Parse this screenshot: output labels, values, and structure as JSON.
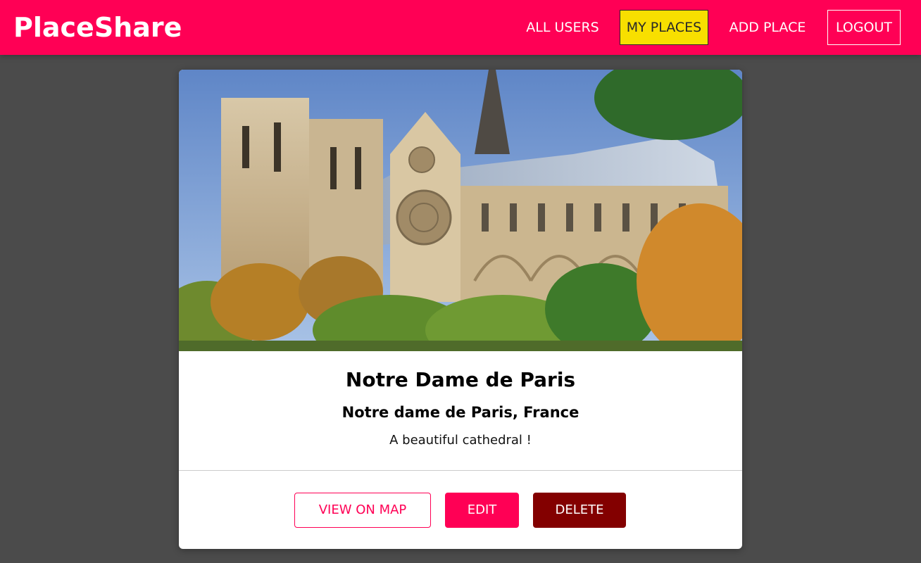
{
  "app": {
    "brand": "PlaceShare"
  },
  "nav": {
    "items": [
      {
        "label": "ALL USERS"
      },
      {
        "label": "MY PLACES"
      },
      {
        "label": "ADD PLACE"
      },
      {
        "label": "LOGOUT"
      }
    ]
  },
  "place": {
    "title": "Notre Dame de Paris",
    "address": "Notre dame de Paris, France",
    "description": "A beautiful cathedral !",
    "actions": {
      "view_on_map": "VIEW ON MAP",
      "edit": "EDIT",
      "delete": "DELETE"
    }
  },
  "colors": {
    "header": "#ff0055",
    "active_nav": "#f8df00",
    "delete": "#830000",
    "background": "#4b4b4b"
  }
}
